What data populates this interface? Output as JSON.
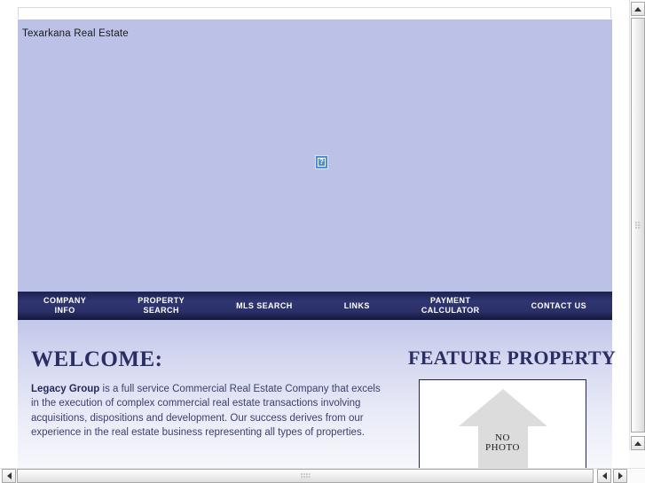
{
  "window": {
    "title": "Texarkana Real Estate"
  },
  "banner": {
    "title": "Texarkana Real Estate",
    "broken_image_icon": "broken-image-icon",
    "broken_image_glyph": "?",
    "background_color": "#bcc1e8"
  },
  "nav": {
    "background_color": "#242a63",
    "items": [
      {
        "label": "COMPANY\nINFO",
        "name": "nav-company-info"
      },
      {
        "label": "PROPERTY\nSEARCH",
        "name": "nav-property-search"
      },
      {
        "label": "MLS SEARCH",
        "name": "nav-mls-search"
      },
      {
        "label": "LINKS",
        "name": "nav-links"
      },
      {
        "label": "PAYMENT\nCALCULATOR",
        "name": "nav-payment-calculator"
      },
      {
        "label": "CONTACT US",
        "name": "nav-contact-us"
      }
    ]
  },
  "content": {
    "welcome": {
      "heading": "WELCOME:",
      "lead": "Legacy Group",
      "body": " is a full service Commercial Real Estate Company that excels in the execution of complex commercial real estate transactions involving acquisitions, dispositions and development. Our success derives from our experience in the real estate business representing all types of properties.",
      "heading_color": "#2a2e63"
    },
    "feature": {
      "heading": "FEATURE PROPERTY",
      "photo_line1": "NO",
      "photo_line2": "PHOTO",
      "photo_alt": "no-photo-placeholder"
    }
  },
  "scrollbars": {
    "vertical": {
      "up_arrow": "scroll-up-icon",
      "down_arrow": "scroll-down-icon"
    },
    "horizontal": {
      "left_arrow": "scroll-left-icon",
      "right_arrow": "scroll-right-icon"
    }
  }
}
